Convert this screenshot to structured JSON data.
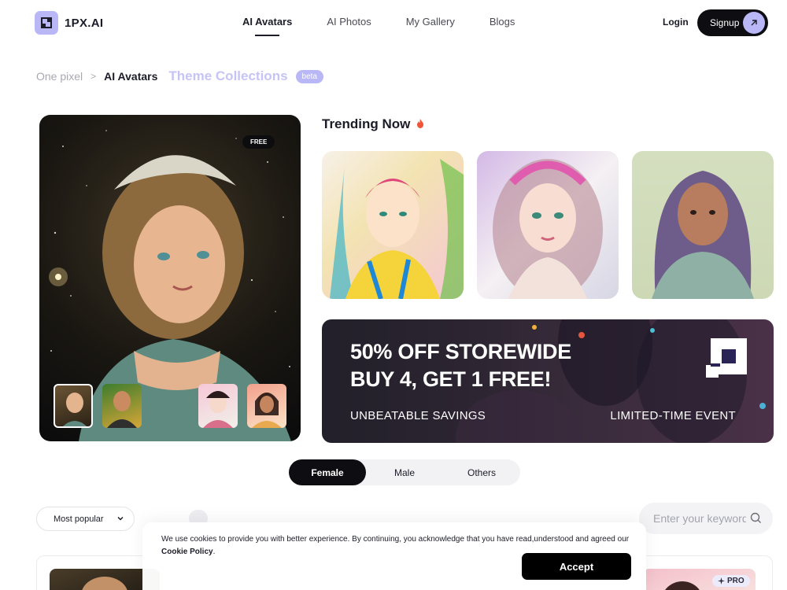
{
  "header": {
    "brand": "1PX.AI",
    "nav": [
      {
        "label": "AI Avatars",
        "active": true
      },
      {
        "label": "AI Photos",
        "active": false
      },
      {
        "label": "My Gallery",
        "active": false
      },
      {
        "label": "Blogs",
        "active": false
      }
    ],
    "login_label": "Login",
    "signup_label": "Signup",
    "accent_color": "#b9b7f6"
  },
  "breadcrumb": {
    "home": "One pixel",
    "separator": ">",
    "current": "AI Avatars",
    "theme_link": "Theme Collections",
    "badge": "beta"
  },
  "hero": {
    "badge": "FREE",
    "thumbnails": [
      "avatar-thumb",
      "avatar-thumb",
      "avatar-thumb",
      "avatar-thumb"
    ],
    "selected_thumbnail": 0
  },
  "trending": {
    "title": "Trending Now",
    "icon": "fire-icon",
    "cards": [
      "trending-avatar",
      "trending-avatar",
      "trending-avatar"
    ]
  },
  "promo": {
    "line1": "50% OFF STOREWIDE",
    "line2": "BUY 4, GET 1 FREE!",
    "left_caption": "UNBEATABLE SAVINGS",
    "right_caption": "LIMITED-TIME EVENT"
  },
  "gender_tabs": [
    {
      "label": "Female",
      "active": true
    },
    {
      "label": "Male",
      "active": false
    },
    {
      "label": "Others",
      "active": false
    }
  ],
  "filters": {
    "sort_label": "Most popular",
    "search_placeholder": "Enter your keywords"
  },
  "gallery": {
    "badge": "PRO"
  },
  "cookie": {
    "text": "We use cookies to provide you with better experience. By continuing, you acknowledge that you have read,understood and agreed our ",
    "link": "Cookie Policy",
    "suffix": ".",
    "accept_label": "Accept"
  }
}
